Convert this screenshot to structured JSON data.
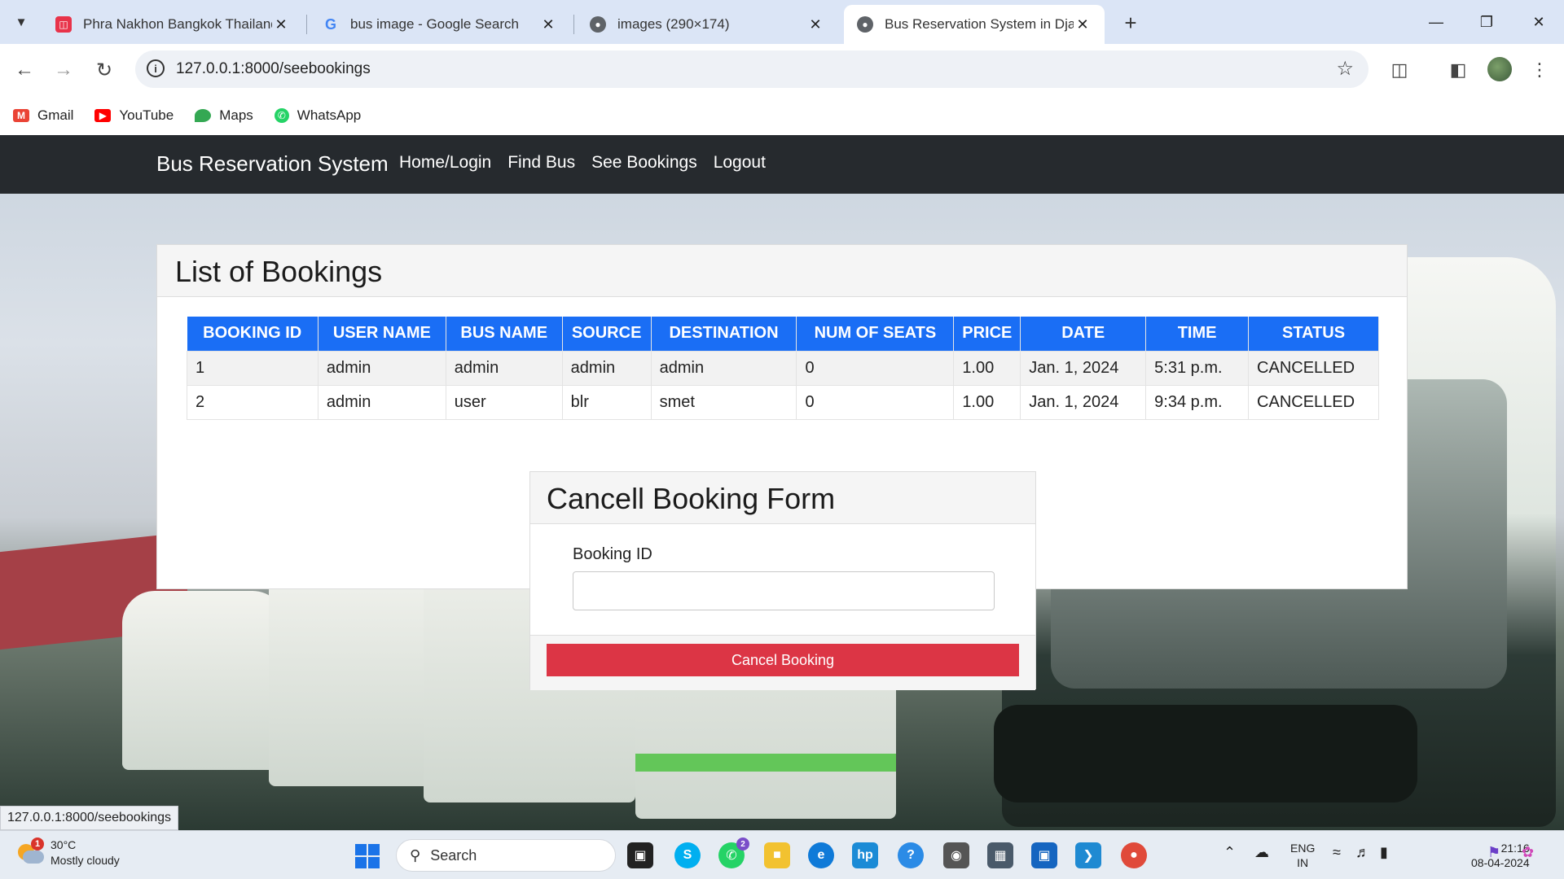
{
  "browser": {
    "tabs": [
      {
        "title": "Phra Nakhon Bangkok Thailand",
        "active": false
      },
      {
        "title": "bus image - Google Search",
        "active": false
      },
      {
        "title": "images (290×174)",
        "active": false
      },
      {
        "title": "Bus Reservation System in Djan",
        "active": true
      }
    ],
    "url": "127.0.0.1:8000/seebookings",
    "bookmarks": [
      "Gmail",
      "YouTube",
      "Maps",
      "WhatsApp"
    ]
  },
  "navbar": {
    "brand": "Bus Reservation System",
    "links": [
      "Home/Login",
      "Find Bus",
      "See Bookings",
      "Logout"
    ]
  },
  "bookings": {
    "title": "List of Bookings",
    "columns": [
      "BOOKING ID",
      "USER NAME",
      "BUS NAME",
      "SOURCE",
      "DESTINATION",
      "NUM OF SEATS",
      "PRICE",
      "DATE",
      "TIME",
      "STATUS"
    ],
    "rows": [
      [
        "1",
        "admin",
        "admin",
        "admin",
        "admin",
        "0",
        "1.00",
        "Jan. 1, 2024",
        "5:31 p.m.",
        "CANCELLED"
      ],
      [
        "2",
        "admin",
        "user",
        "blr",
        "smet",
        "0",
        "1.00",
        "Jan. 1, 2024",
        "9:34 p.m.",
        "CANCELLED"
      ]
    ]
  },
  "cancel_form": {
    "title": "Cancell Booking Form",
    "field_label": "Booking ID",
    "field_value": "",
    "button": "Cancel Booking"
  },
  "status_bar_url": "127.0.0.1:8000/seebookings",
  "taskbar": {
    "weather_temp": "30°C",
    "weather_desc": "Mostly cloudy",
    "weather_badge": "1",
    "search_label": "Search",
    "whatsapp_badge": "2",
    "lang_line1": "ENG",
    "lang_line2": "IN",
    "time": "21:16",
    "date": "08-04-2024"
  },
  "colors": {
    "navbar_bg": "#262a2e",
    "table_header": "#1a6ef5",
    "cancel_button": "#dc3545",
    "tabbar_bg": "#dbe5f6"
  }
}
